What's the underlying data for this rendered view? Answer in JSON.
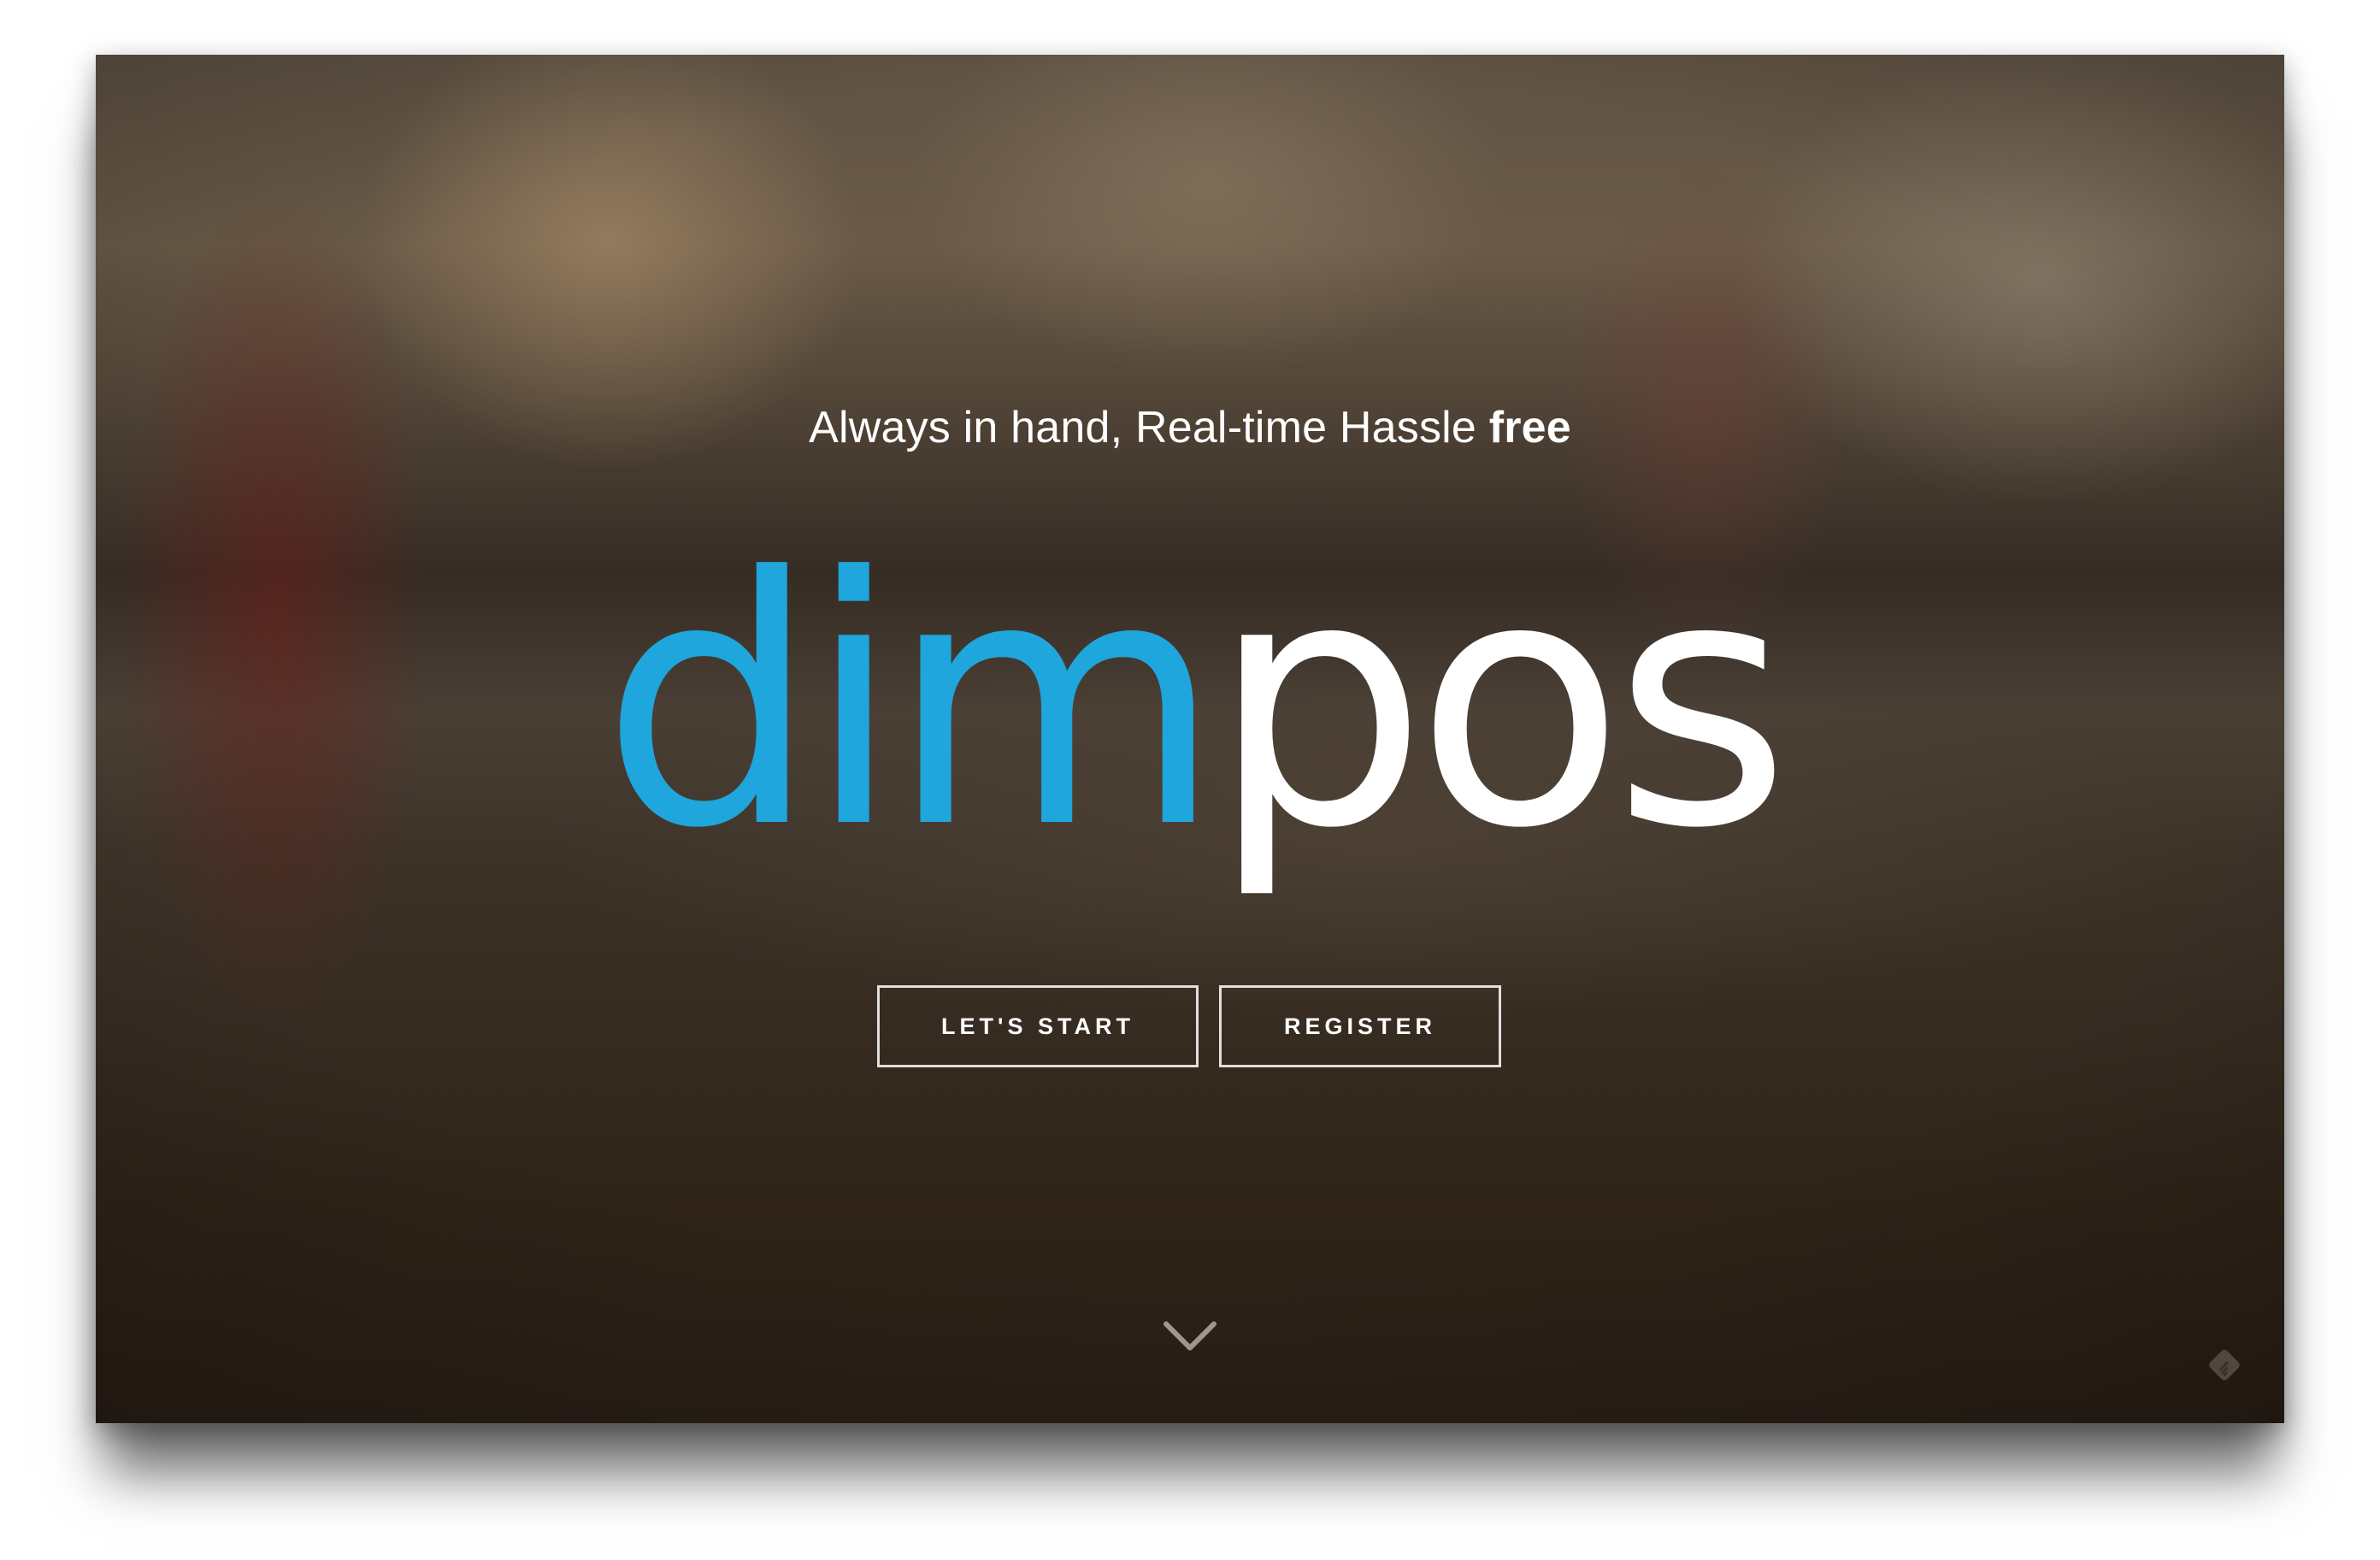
{
  "hero": {
    "tagline_main": "Always in hand, Real-time Hassle",
    "tagline_bold": "free",
    "logo_part1": "dim",
    "logo_part2": "pos"
  },
  "buttons": {
    "start_label": "LET'S START",
    "register_label": "REGISTER"
  },
  "icons": {
    "scroll": "chevron-down-icon",
    "corner": "feedly-icon"
  },
  "colors": {
    "logo_accent": "#1fa6dc",
    "text": "#ffffff"
  }
}
